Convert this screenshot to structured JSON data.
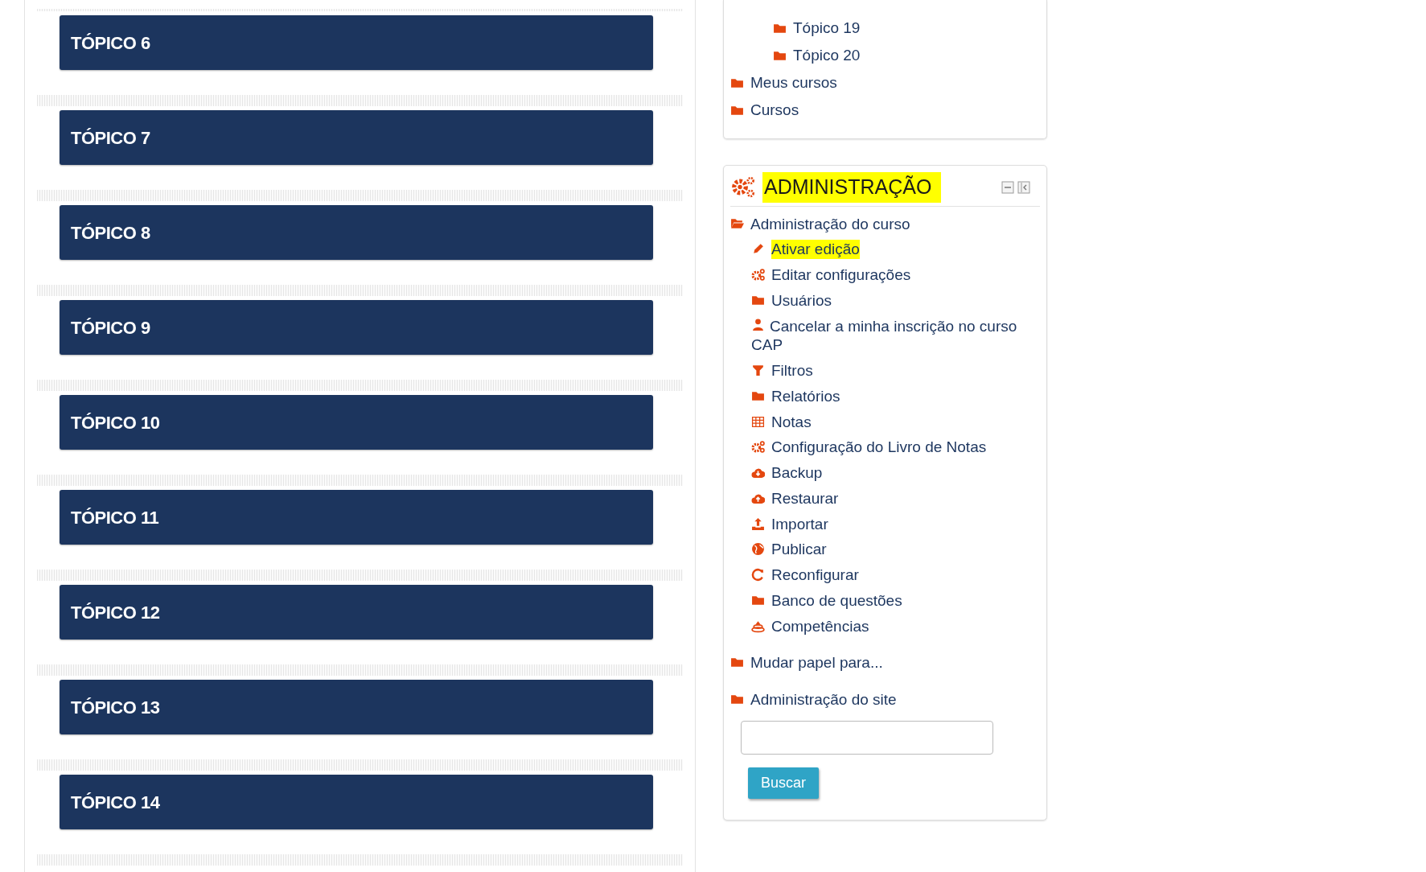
{
  "topics": [
    {
      "title": "TÓPICO 6"
    },
    {
      "title": "TÓPICO 7"
    },
    {
      "title": "TÓPICO 8"
    },
    {
      "title": "TÓPICO 9"
    },
    {
      "title": "TÓPICO 10"
    },
    {
      "title": "TÓPICO 11"
    },
    {
      "title": "TÓPICO 12"
    },
    {
      "title": "TÓPICO 13"
    },
    {
      "title": "TÓPICO 14"
    }
  ],
  "navigation": {
    "continued_children": [
      {
        "label": "Tópico 19",
        "kind": "folder"
      },
      {
        "label": "Tópico 20",
        "kind": "folder"
      }
    ],
    "items": [
      {
        "label": "Meus cursos",
        "kind": "folder"
      },
      {
        "label": "Cursos",
        "kind": "folder"
      }
    ]
  },
  "administration": {
    "title": "ADMINISTRAÇÃO",
    "highlighted": true,
    "items": [
      {
        "label": "Administração do curso",
        "kind": "folder-open",
        "highlighted": false,
        "children": [
          {
            "label": "Ativar edição",
            "kind": "pencil",
            "highlighted": true
          },
          {
            "label": "Editar configurações",
            "kind": "gears",
            "highlighted": false
          },
          {
            "label": "Usuários",
            "kind": "folder",
            "highlighted": false
          },
          {
            "label": "Cancelar a minha inscrição no curso CAP",
            "kind": "user",
            "highlighted": false
          },
          {
            "label": "Filtros",
            "kind": "filter",
            "highlighted": false
          },
          {
            "label": "Relatórios",
            "kind": "folder",
            "highlighted": false
          },
          {
            "label": "Notas",
            "kind": "table",
            "highlighted": false
          },
          {
            "label": "Configuração do Livro de Notas",
            "kind": "gears",
            "highlighted": false
          },
          {
            "label": "Backup",
            "kind": "cloud-down",
            "highlighted": false
          },
          {
            "label": "Restaurar",
            "kind": "cloud-up",
            "highlighted": false
          },
          {
            "label": "Importar",
            "kind": "upload",
            "highlighted": false
          },
          {
            "label": "Publicar",
            "kind": "globe",
            "highlighted": false
          },
          {
            "label": "Reconfigurar",
            "kind": "refresh",
            "highlighted": false
          },
          {
            "label": "Banco de questões",
            "kind": "folder",
            "highlighted": false
          },
          {
            "label": "Competências",
            "kind": "stack",
            "highlighted": false
          }
        ]
      },
      {
        "label": "Mudar papel para...",
        "kind": "folder",
        "highlighted": false
      },
      {
        "label": "Administração do site",
        "kind": "folder",
        "highlighted": false
      }
    ],
    "search": {
      "button": "Buscar"
    }
  }
}
